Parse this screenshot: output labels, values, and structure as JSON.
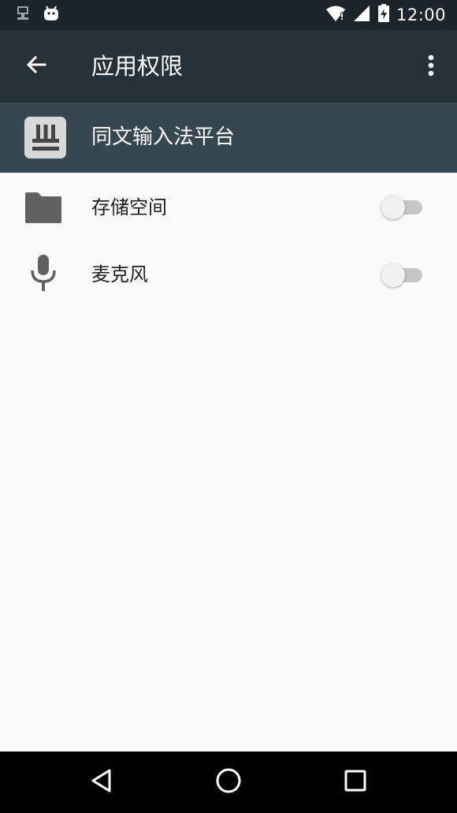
{
  "status_bar": {
    "time": "12:00",
    "icons": [
      "network-icon",
      "android-icon",
      "wifi-icon",
      "signal-icon",
      "battery-icon"
    ]
  },
  "app_bar": {
    "title": "应用权限",
    "back_icon": "arrow-back-icon",
    "menu_icon": "more-vert-icon",
    "background": "#263238"
  },
  "app_header": {
    "app_name": "同文输入法平台",
    "icon": "app-logo-icon",
    "background": "#37474f"
  },
  "permissions": [
    {
      "label": "存储空间",
      "icon": "folder-icon",
      "enabled": false
    },
    {
      "label": "麦克风",
      "icon": "microphone-icon",
      "enabled": false
    }
  ],
  "nav_bar": {
    "buttons": [
      "back-triangle-icon",
      "home-circle-icon",
      "recents-square-icon"
    ]
  }
}
